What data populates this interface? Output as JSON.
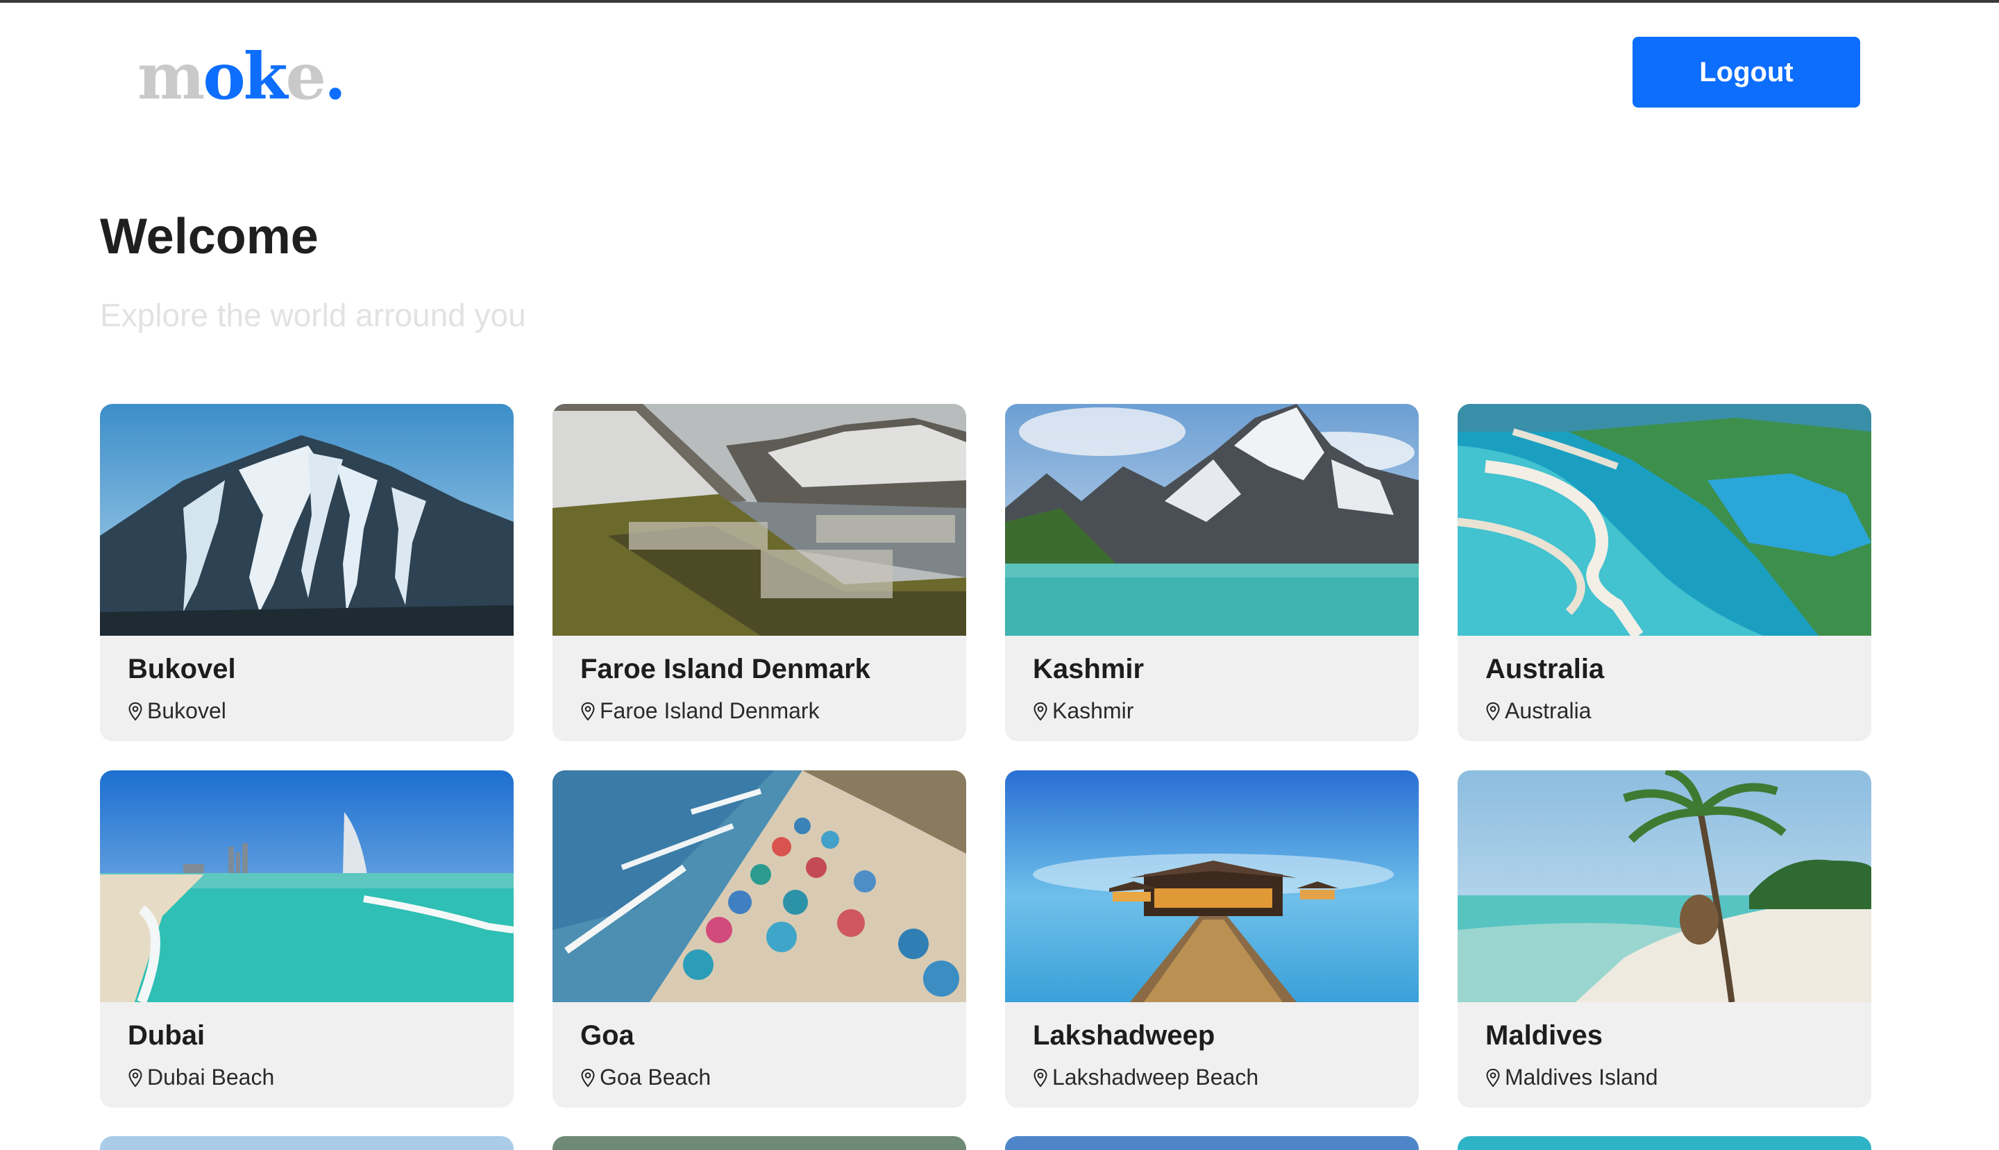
{
  "brand": {
    "logo_parts": [
      "m",
      "ok",
      "e",
      "."
    ]
  },
  "header": {
    "logout_label": "Logout"
  },
  "hero": {
    "title": "Welcome",
    "subtitle": "Explore the world arround you"
  },
  "destinations": [
    {
      "name": "Bukovel",
      "location": "Bukovel",
      "scene": "ski-mountain"
    },
    {
      "name": "Faroe Island Denmark",
      "location": "Faroe Island Denmark",
      "scene": "fjord-town"
    },
    {
      "name": "Kashmir",
      "location": "Kashmir",
      "scene": "alpine-lake"
    },
    {
      "name": "Australia",
      "location": "Australia",
      "scene": "aerial-coast"
    },
    {
      "name": "Dubai",
      "location": "Dubai Beach",
      "scene": "city-beach"
    },
    {
      "name": "Goa",
      "location": "Goa Beach",
      "scene": "umbrella-beach"
    },
    {
      "name": "Lakshadweep",
      "location": "Lakshadweep Beach",
      "scene": "water-villa"
    },
    {
      "name": "Maldives",
      "location": "Maldives Island",
      "scene": "palm-beach"
    }
  ],
  "icons": {
    "location": "map-pin-icon"
  },
  "colors": {
    "accent": "#0d6efd",
    "card_bg": "#f0f0f0",
    "subtitle": "#e2e2e2"
  }
}
